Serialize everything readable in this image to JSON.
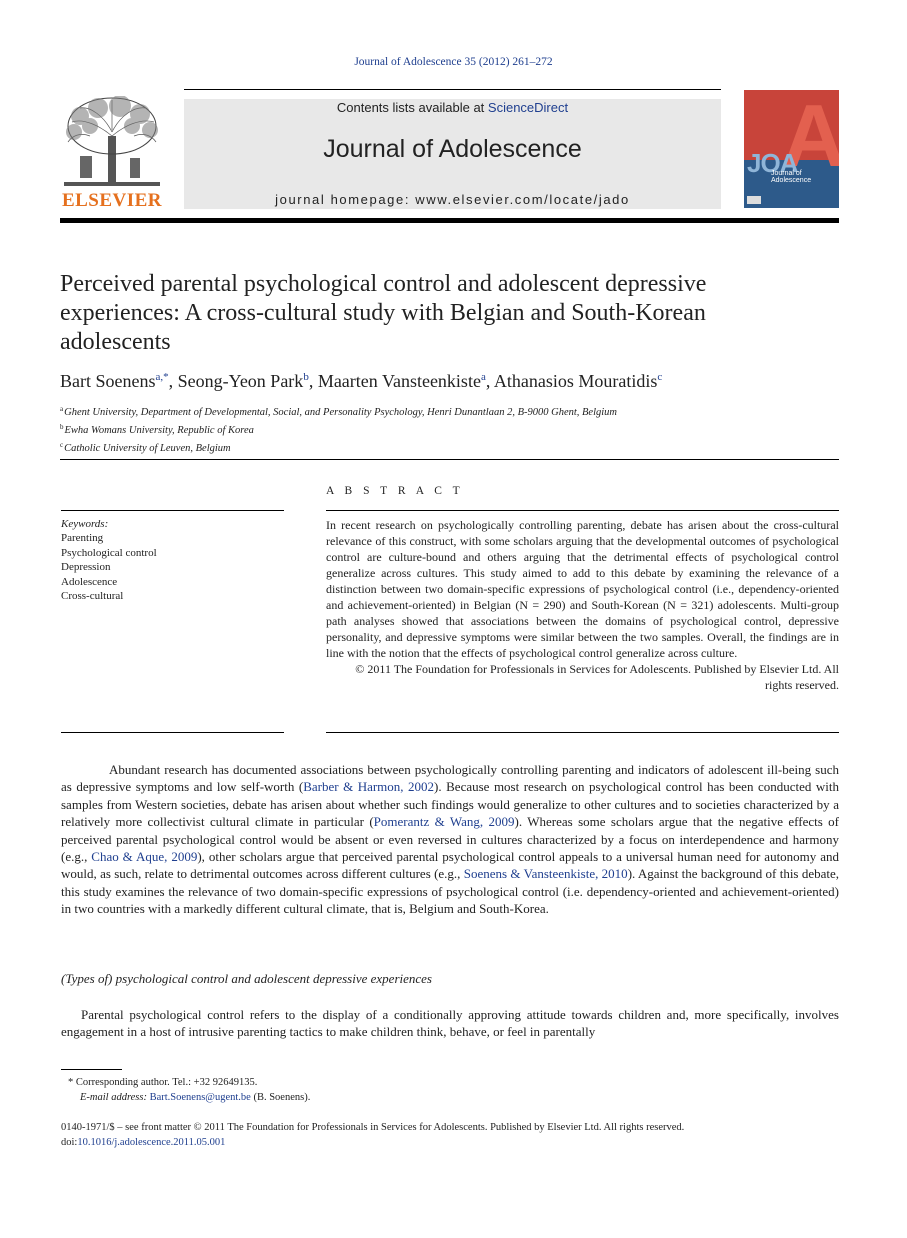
{
  "journal_reference": "Journal of Adolescence 35 (2012) 261–272",
  "header": {
    "publisher_logo_text": "ELSEVIER",
    "contents_prefix": "Contents lists available at ",
    "contents_link": "ScienceDirect",
    "journal_title": "Journal of Adolescence",
    "homepage": "journal homepage: www.elsevier.com/locate/jado",
    "cover": {
      "letters": "JOA",
      "big_letter": "A",
      "subtitle": "Journal of Adolescence"
    }
  },
  "article": {
    "title": "Perceived parental psychological control and adolescent depressive experiences: A cross-cultural study with Belgian and South-Korean adolescents",
    "authors": [
      {
        "name": "Bart Soenens",
        "sup": "a,*"
      },
      {
        "name": "Seong-Yeon Park",
        "sup": "b"
      },
      {
        "name": "Maarten Vansteenkiste",
        "sup": "a"
      },
      {
        "name": "Athanasios Mouratidis",
        "sup": "c"
      }
    ],
    "affiliations": [
      {
        "sup": "a",
        "text": "Ghent University, Department of Developmental, Social, and Personality Psychology, Henri Dunantlaan 2, B-9000 Ghent, Belgium"
      },
      {
        "sup": "b",
        "text": "Ewha Womans University, Republic of Korea"
      },
      {
        "sup": "c",
        "text": "Catholic University of Leuven, Belgium"
      }
    ]
  },
  "abstract": {
    "heading": "A B S T R A C T",
    "keywords_label": "Keywords:",
    "keywords": [
      "Parenting",
      "Psychological control",
      "Depression",
      "Adolescence",
      "Cross-cultural"
    ],
    "body": "In recent research on psychologically controlling parenting, debate has arisen about the cross-cultural relevance of this construct, with some scholars arguing that the developmental outcomes of psychological control are culture-bound and others arguing that the detrimental effects of psychological control generalize across cultures. This study aimed to add to this debate by examining the relevance of a distinction between two domain-specific expressions of psychological control (i.e., dependency-oriented and achievement-oriented) in Belgian (N = 290) and South-Korean (N = 321) adolescents. Multi-group path analyses showed that associations between the domains of psychological control, depressive personality, and depressive symptoms were similar between the two samples. Overall, the findings are in line with the notion that the effects of psychological control generalize across culture.",
    "copyright": "© 2011 The Foundation for Professionals in Services for Adolescents. Published by Elsevier Ltd. All rights reserved."
  },
  "body": {
    "intro": [
      {
        "t": "text",
        "v": "Abundant research has documented associations between psychologically controlling parenting and indicators of adolescent ill-being such as depressive symptoms and low self-worth ("
      },
      {
        "t": "link",
        "v": "Barber & Harmon, 2002"
      },
      {
        "t": "text",
        "v": "). Because most research on psychological control has been conducted with samples from Western societies, debate has arisen about whether such findings would generalize to other cultures and to societies characterized by a relatively more collectivist cultural climate in particular ("
      },
      {
        "t": "link",
        "v": "Pomerantz & Wang, 2009"
      },
      {
        "t": "text",
        "v": "). Whereas some scholars argue that the negative effects of perceived parental psychological control would be absent or even reversed in cultures characterized by a focus on interdependence and harmony (e.g., "
      },
      {
        "t": "link",
        "v": "Chao & Aque, 2009"
      },
      {
        "t": "text",
        "v": "), other scholars argue that perceived parental psychological control appeals to a universal human need for autonomy and would, as such, relate to detrimental outcomes across different cultures (e.g., "
      },
      {
        "t": "link",
        "v": "Soenens & Vansteenkiste, 2010"
      },
      {
        "t": "text",
        "v": "). Against the background of this debate, this study examines the relevance of two domain-specific expressions of psychological control (i.e. dependency-oriented and achievement-oriented) in two countries with a markedly different cultural climate, that is, Belgium and South-Korea."
      }
    ],
    "section_heading": "(Types of) psychological control and adolescent depressive experiences",
    "second_para": "Parental psychological control refers to the display of a conditionally approving attitude towards children and, more specifically, involves engagement in a host of intrusive parenting tactics to make children think, behave, or feel in parentally"
  },
  "footnotes": {
    "corresponding": "* Corresponding author. Tel.: +32 92649135.",
    "email_label": "E-mail address: ",
    "email": "Bart.Soenens@ugent.be",
    "email_suffix": " (B. Soenens)."
  },
  "front_matter": {
    "line1": "0140-1971/$ – see front matter © 2011 The Foundation for Professionals in Services for Adolescents. Published by Elsevier Ltd. All rights reserved.",
    "doi_prefix": "doi:",
    "doi": "10.1016/j.adolescence.2011.05.001"
  },
  "colors": {
    "link": "#1f3f8f",
    "elsevier_orange": "#e5701e",
    "header_gray": "#e8e8e8"
  }
}
